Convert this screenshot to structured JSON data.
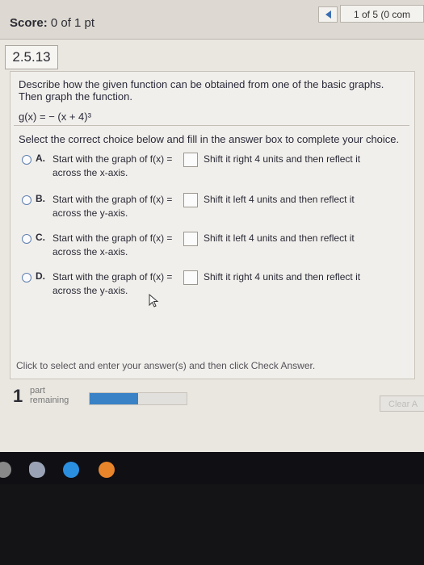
{
  "header": {
    "score_label": "Score:",
    "score_value": "0 of 1 pt",
    "progress": "1 of 5 (0 com"
  },
  "question": {
    "number": "2.5.13",
    "description": "Describe how the given function can be obtained from one of the basic graphs. Then graph the function.",
    "function": "g(x) = − (x + 4)³",
    "instruction": "Select the correct choice below and fill in the answer box to complete your choice."
  },
  "choices": [
    {
      "letter": "A.",
      "start": "Start with the graph of f(x) =",
      "shift": "Shift it right 4 units and then reflect it",
      "cont": "across the x-axis."
    },
    {
      "letter": "B.",
      "start": "Start with the graph of f(x) =",
      "shift": "Shift it left 4 units and then reflect it",
      "cont": "across the y-axis."
    },
    {
      "letter": "C.",
      "start": "Start with the graph of f(x) =",
      "shift": "Shift it left 4 units and then reflect it",
      "cont": "across the x-axis."
    },
    {
      "letter": "D.",
      "start": "Start with the graph of f(x) =",
      "shift": "Shift it right 4 units and then reflect it",
      "cont": "across the y-axis."
    }
  ],
  "footer": {
    "help": "Click to select and enter your answer(s) and then click Check Answer.",
    "parts_count": "1",
    "parts_label_1": "part",
    "parts_label_2": "remaining",
    "progress_fraction": 0.5,
    "clear_label": "Clear A"
  },
  "colors": {
    "accent": "#3a82c6",
    "radio": "#5e7fb0"
  }
}
